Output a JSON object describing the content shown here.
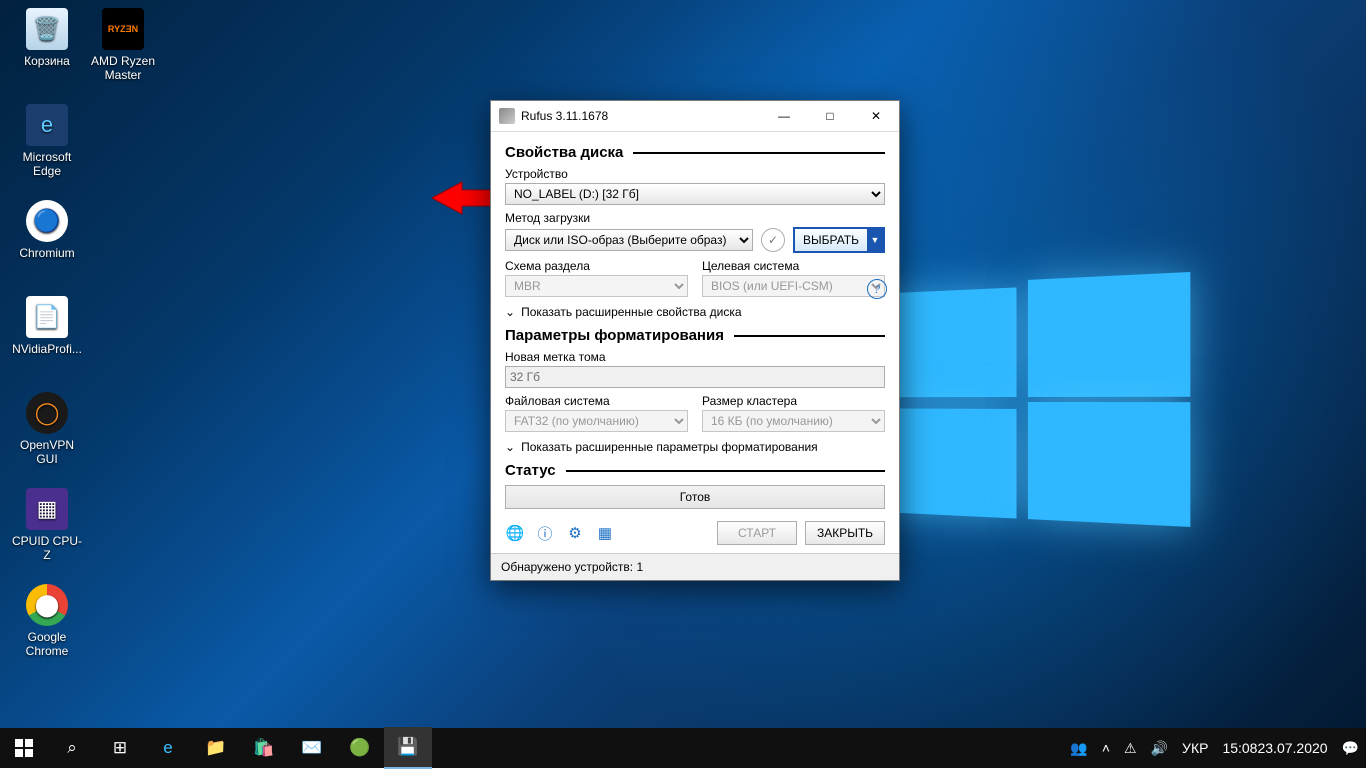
{
  "desktop_icons": [
    {
      "label": "Корзина"
    },
    {
      "label": "AMD Ryzen Master"
    },
    {
      "label": "Microsoft Edge"
    },
    {
      "label": "Chromium"
    },
    {
      "label": "NVidiaProfi..."
    },
    {
      "label": "OpenVPN GUI"
    },
    {
      "label": "CPUID CPU-Z"
    },
    {
      "label": "Google Chrome"
    }
  ],
  "window": {
    "title": "Rufus 3.11.1678",
    "section_disk": "Свойства диска",
    "device_label": "Устройство",
    "device_value": "NO_LABEL (D:) [32 Гб]",
    "boot_label": "Метод загрузки",
    "boot_value": "Диск или ISO-образ (Выберите образ)",
    "select_btn": "ВЫБРАТЬ",
    "partition_label": "Схема раздела",
    "partition_value": "MBR",
    "target_label": "Целевая система",
    "target_value": "BIOS (или UEFI-CSM)",
    "expand_disk": "Показать расширенные свойства диска",
    "section_format": "Параметры форматирования",
    "volume_label": "Новая метка тома",
    "volume_value": "32 Гб",
    "fs_label": "Файловая система",
    "fs_value": "FAT32 (по умолчанию)",
    "cluster_label": "Размер кластера",
    "cluster_value": "16 КБ (по умолчанию)",
    "expand_format": "Показать расширенные параметры форматирования",
    "section_status": "Статус",
    "status_value": "Готов",
    "start_btn": "СТАРТ",
    "close_btn": "ЗАКРЫТЬ",
    "footer": "Обнаружено устройств: 1"
  },
  "taskbar": {
    "lang": "УКР",
    "time": "15:08",
    "date": "23.07.2020"
  }
}
